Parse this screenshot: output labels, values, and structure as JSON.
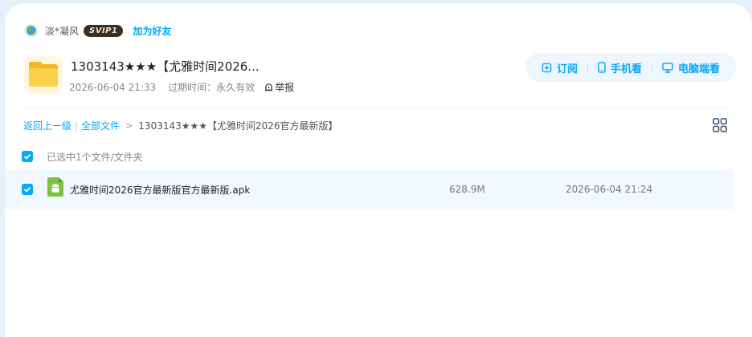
{
  "user": {
    "name": "淡*凝风",
    "badge": "SVIP1",
    "add_friend": "加为好友"
  },
  "share": {
    "title": "1303143★★★【尤雅时间2026...",
    "created": "2026-06-04 21:33",
    "expire_label": "过期时间：永久有效",
    "report_label": "举报"
  },
  "actions": {
    "subscribe": "订阅",
    "phone": "手机看",
    "pc": "电脑端看"
  },
  "breadcrumb": {
    "back": "返回上一级",
    "all_files": "全部文件",
    "current": "1303143★★★【尤雅时间2026官方最新版】"
  },
  "selection": {
    "text": "已选中1个文件/文件夹"
  },
  "files": [
    {
      "name": "尤雅时间2026官方最新版官方最新版.apk",
      "size": "628.9M",
      "time": "2026-06-04 21:24"
    }
  ],
  "colors": {
    "accent": "#06a7ff",
    "row_highlight": "#f1f8ff",
    "page_bg": "#e6f0fb",
    "apk_green": "#7cc242"
  }
}
